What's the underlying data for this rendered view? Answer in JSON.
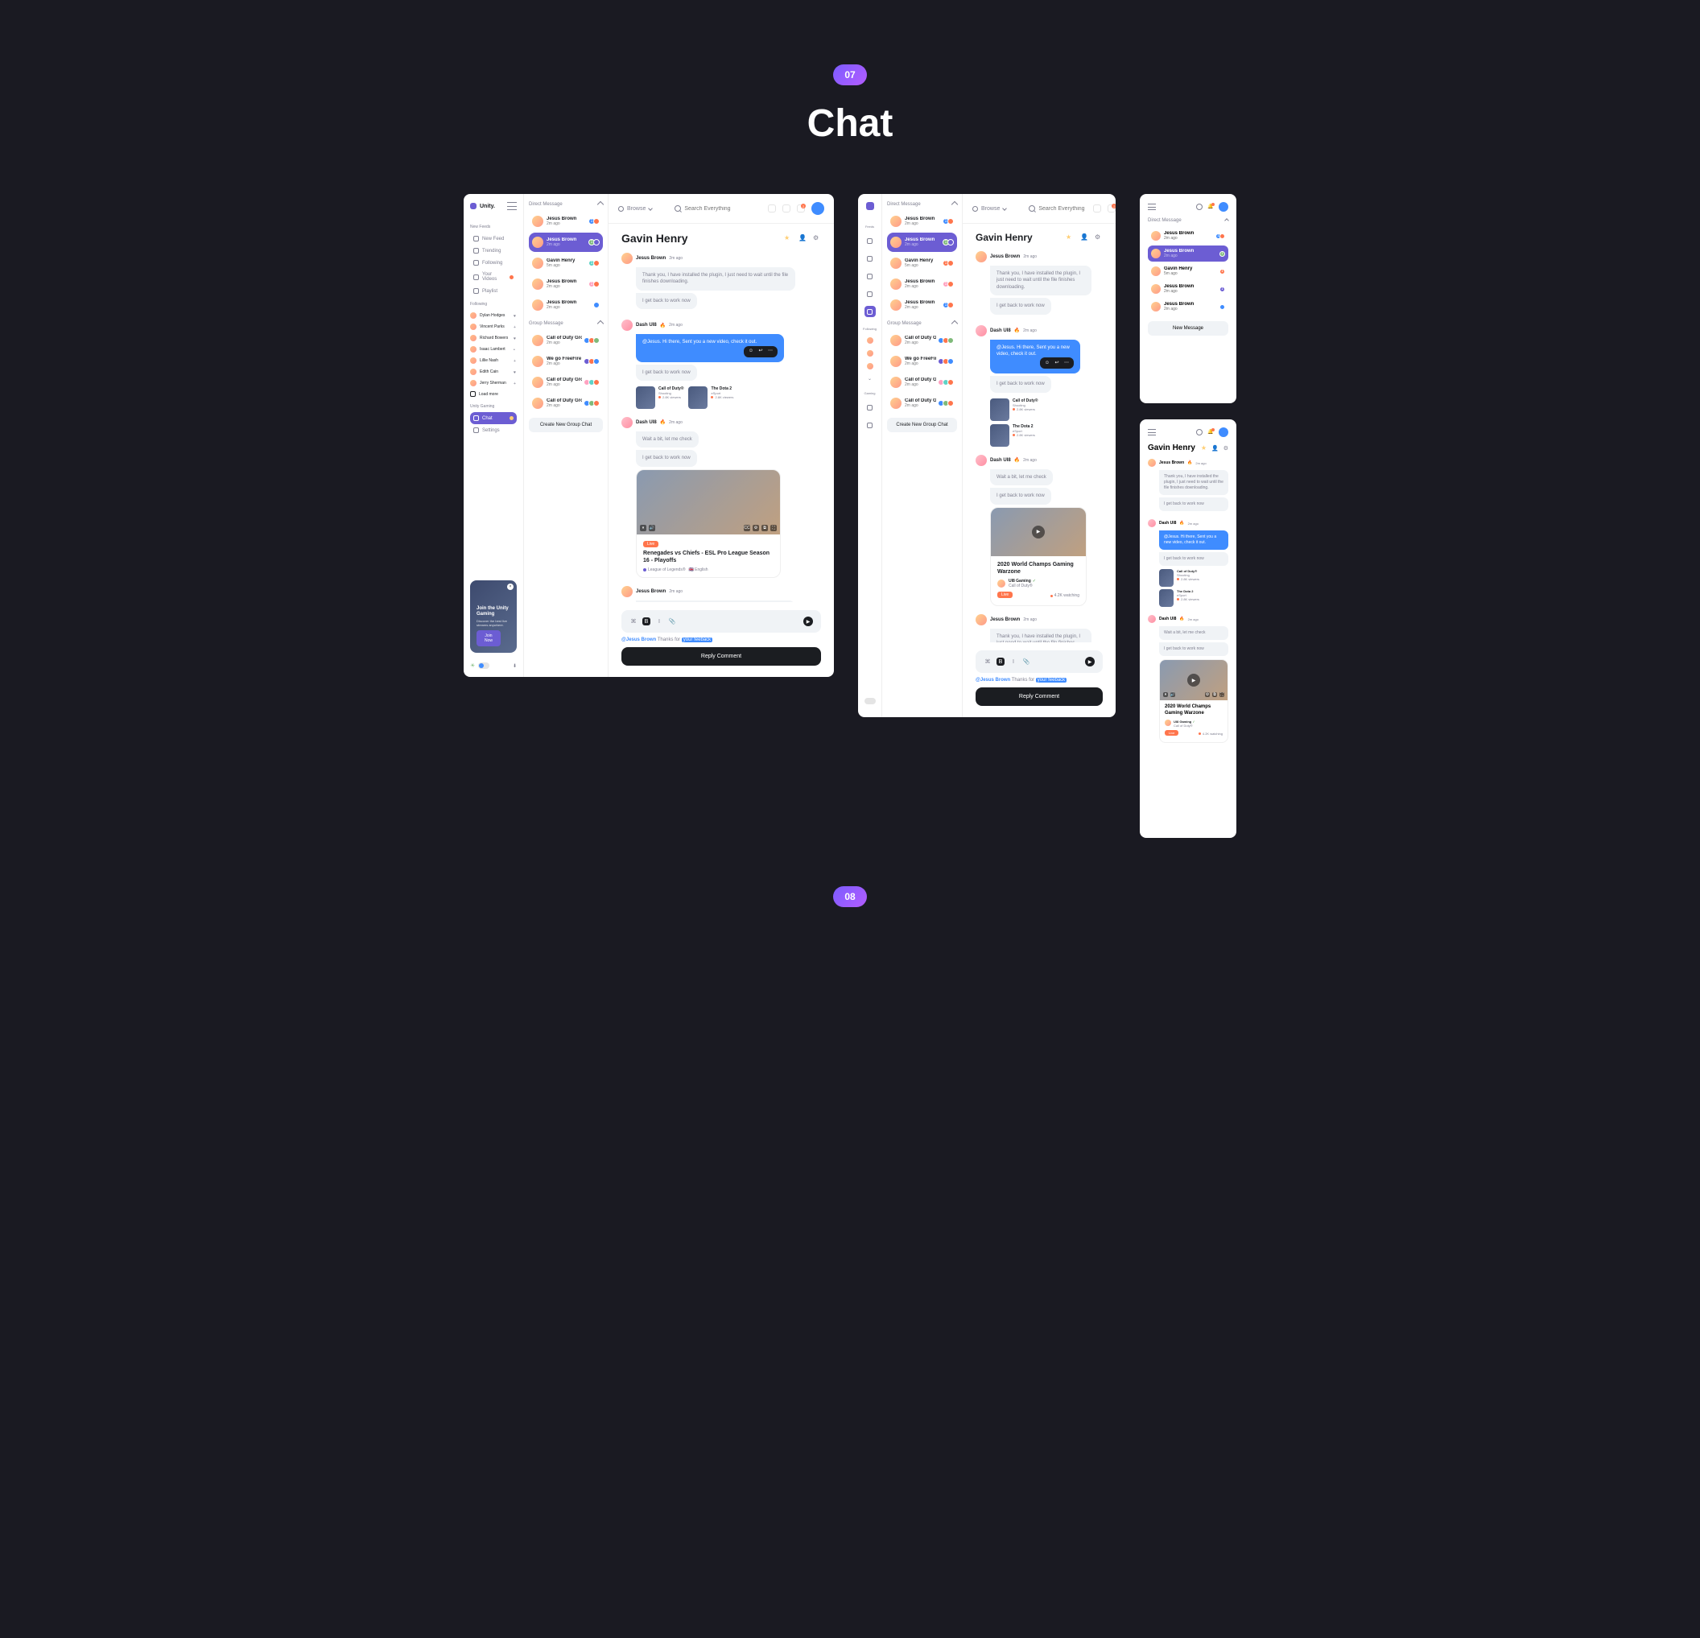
{
  "page": {
    "number": "07",
    "title": "Chat",
    "next_number": "08"
  },
  "brand": "Unity.",
  "topbar": {
    "browse": "Browse",
    "search_placeholder": "Search Everything",
    "notif_count": "2"
  },
  "nav": {
    "section_feeds": "New Feeds",
    "items": [
      {
        "label": "New Feed"
      },
      {
        "label": "Trending"
      },
      {
        "label": "Following"
      },
      {
        "label": "Your Videos"
      },
      {
        "label": "Playlist"
      }
    ],
    "section_following": "Following",
    "following": [
      {
        "name": "Dylan Hodges"
      },
      {
        "name": "Vincent Parks"
      },
      {
        "name": "Richard Bowers"
      },
      {
        "name": "Isaac Lambert"
      },
      {
        "name": "Lillie Nash"
      },
      {
        "name": "Edith Cain"
      },
      {
        "name": "Jerry Sherman"
      }
    ],
    "load_more": "Load more",
    "section_unity": "Unity Gaming",
    "chat_label": "Chat",
    "settings_label": "Settings"
  },
  "promo": {
    "title": "Join the Unity Gaming",
    "subtitle": "Discover the best live streams anywhere.",
    "cta": "Join Now"
  },
  "dm": {
    "header": "Direct Message",
    "group_header": "Group Message",
    "new_group": "Create New Group Chat",
    "new_message": "New Message",
    "items": [
      {
        "name": "Jesus Brown",
        "time": "2m ago",
        "badges": [
          "b-blue",
          "b-orange"
        ]
      },
      {
        "name": "Jesus Brown",
        "time": "2m ago",
        "badges": [
          "b-green",
          "b-purple"
        ],
        "active": true
      },
      {
        "name": "Gavin Henry",
        "time": "5m ago",
        "badges": [
          "b-teal",
          "b-orange"
        ]
      },
      {
        "name": "Jesus Brown",
        "time": "2m ago",
        "badges": [
          "b-pink",
          "b-orange"
        ]
      },
      {
        "name": "Jesus Brown",
        "time": "2m ago",
        "badges": [
          "b-blue"
        ]
      }
    ],
    "groups": [
      {
        "name": "Call of Duty Group",
        "time": "2m ago"
      },
      {
        "name": "We go FreeFire",
        "time": "2m ago"
      },
      {
        "name": "Call of Duty Group",
        "time": "2m ago"
      },
      {
        "name": "Call of Duty Group",
        "time": "2m ago"
      }
    ]
  },
  "chat": {
    "title": "Gavin Henry",
    "messages": {
      "m1": {
        "author": "Jesus Brown",
        "time": "2m ago",
        "text1": "Thank you, I have installed the plugin, I just need to wait until the file finishes downloading.",
        "text2": "I get back to work now"
      },
      "m2": {
        "author": "Dash UI8",
        "time": "2m ago",
        "text1": "@Jesus. Hi there, Sent you a new video, check it out.",
        "text2": "I get back to work now"
      },
      "m3": {
        "author": "Dash UI8",
        "time": "2m ago",
        "text1": "Wait a bit, let me check",
        "text2": "I get back to work now"
      },
      "m4": {
        "author": "Jesus Brown",
        "time": "2m ago",
        "text1": "Thank you, I have installed the plugin, I just need to wait until the file finishes downloading."
      }
    },
    "games": [
      {
        "name": "Call of Duty®",
        "cat": "Shooting",
        "views": "2.8K viewers"
      },
      {
        "name": "The Dota 2",
        "cat": "eSport",
        "views": "2.8K viewers"
      }
    ],
    "video1": {
      "live": "Live",
      "title": "Renegades vs Chiefs - ESL Pro League Season 16 - Playoffs",
      "meta1": "League of Legends®",
      "meta2": "🇬🇧 English"
    },
    "video2": {
      "live": "Live",
      "title": "2020 World Champs Gaming Warzone",
      "author": "UI8 Gaming",
      "game": "Call of Duty®",
      "watching": "4.2K watching"
    },
    "reply": {
      "mention_user": "@Jesus Brown",
      "mention_text": "Thanks for",
      "mention_highlight": "your feeback",
      "button": "Reply Comment"
    }
  }
}
